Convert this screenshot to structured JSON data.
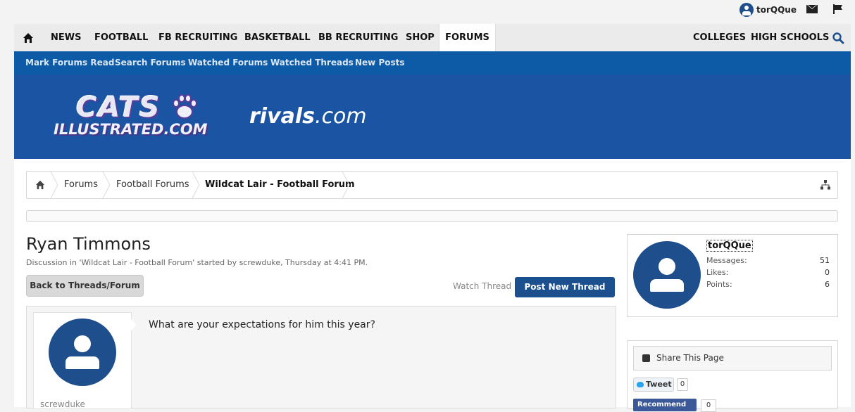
{
  "topbar": {
    "username": "torQQue",
    "icons": [
      "avatar-icon",
      "mail-icon",
      "flag-icon"
    ]
  },
  "nav": {
    "items": [
      "NEWS",
      "FOOTBALL",
      "FB RECRUITING",
      "BASKETBALL",
      "BB RECRUITING",
      "SHOP",
      "FORUMS"
    ],
    "right_items": [
      "COLLEGES",
      "HIGH SCHOOLS"
    ],
    "active": "FORUMS"
  },
  "subnav": {
    "items": [
      "Mark Forums Read",
      "Search Forums",
      "Watched Forums",
      "Watched Threads",
      "New Posts"
    ]
  },
  "banner": {
    "logo_line1": "CATS",
    "logo_line2": "ILLUSTRATED.COM",
    "partner_bold": "rivals",
    "partner_rest": ".com"
  },
  "breadcrumb": {
    "items": [
      "Forums",
      "Football Forums"
    ],
    "current": "Wildcat Lair - Football Forum"
  },
  "thread": {
    "title": "Ryan Timmons",
    "description": "Discussion in 'Wildcat Lair - Football Forum' started by screwduke, Thursday at 4:41 PM.",
    "back_button": "Back to Threads/Forum",
    "watch_link": "Watch Thread",
    "post_button": "Post New Thread"
  },
  "post": {
    "author": "screwduke",
    "text": "What are your expectations for him this year?"
  },
  "sidebar": {
    "username": "torQQue",
    "stats": [
      {
        "label": "Messages:",
        "value": "51"
      },
      {
        "label": "Likes:",
        "value": "0"
      },
      {
        "label": "Points:",
        "value": "6"
      }
    ],
    "share_title": "Share This Page",
    "tweet_label": "Tweet",
    "tweet_count": "0",
    "fb_label": "Recommend",
    "fb_count": "0"
  },
  "colors": {
    "nav_blue": "#0d5aa7",
    "banner_blue": "#1b54a2",
    "button_blue": "#1b4f8e",
    "avatar_blue": "#1f4e8c"
  }
}
